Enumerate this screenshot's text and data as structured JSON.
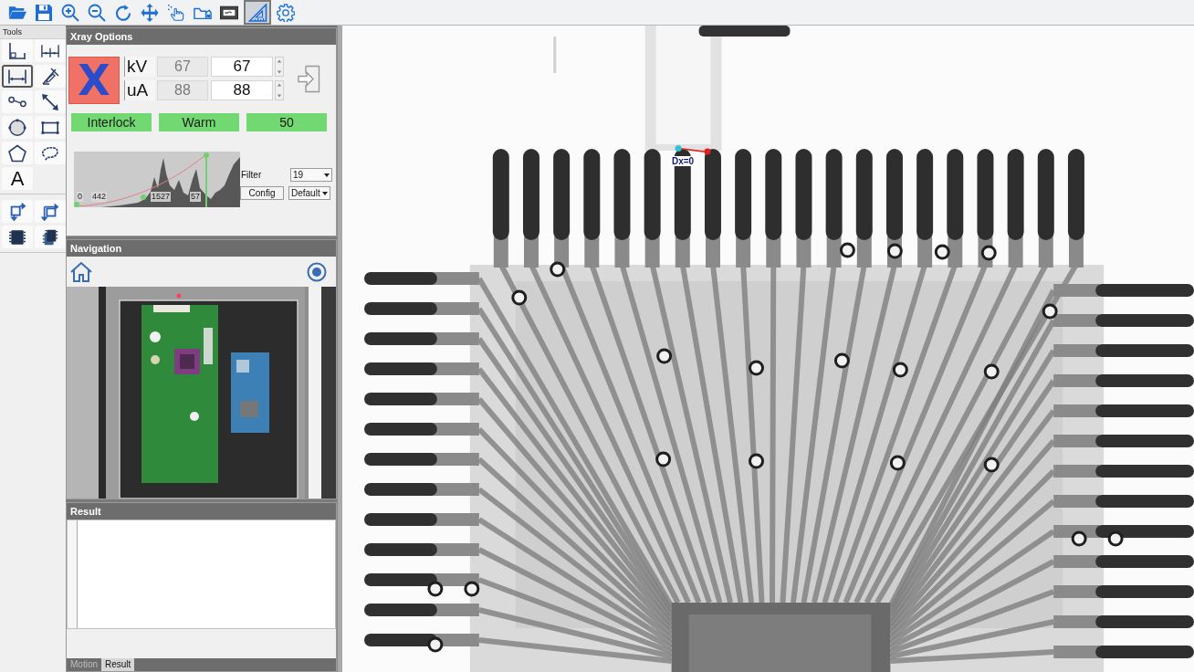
{
  "toolbar": {
    "buttons": [
      {
        "selected": false
      },
      {
        "selected": false
      },
      {
        "selected": false
      },
      {
        "selected": false
      },
      {
        "selected": false
      },
      {
        "selected": false
      },
      {
        "selected": false
      },
      {
        "selected": false
      },
      {
        "selected": false
      },
      {
        "selected": true
      },
      {
        "selected": false
      }
    ]
  },
  "tools": {
    "title": "Tools",
    "groups": [
      {
        "items": [
          {
            "selected": false
          },
          {
            "selected": false
          },
          {
            "selected": true
          },
          {
            "selected": false
          },
          {
            "selected": false
          },
          {
            "selected": false
          },
          {
            "selected": false
          },
          {
            "selected": false
          },
          {
            "selected": false
          },
          {
            "selected": false
          },
          {
            "label": "A",
            "selected": false
          }
        ]
      },
      {
        "items": [
          {
            "selected": false
          },
          {
            "selected": false
          },
          {
            "selected": false
          },
          {
            "selected": false
          }
        ]
      }
    ]
  },
  "xray_options": {
    "title": "Xray Options",
    "source_button": {
      "label": "X"
    },
    "parameters": [
      {
        "label": "kV",
        "reading": "67",
        "value": "67"
      },
      {
        "label": "uA",
        "reading": "88",
        "value": "88"
      }
    ],
    "status": [
      {
        "label": "Interlock"
      },
      {
        "label": "Warm"
      },
      {
        "label": "50"
      }
    ],
    "histogram": {
      "ticks": [
        "0",
        "442",
        "1527",
        "57"
      ]
    },
    "filter": {
      "label": "Filter",
      "value": "19"
    },
    "config_button": "Config",
    "preset": {
      "value": "Default"
    }
  },
  "navigation": {
    "title": "Navigation"
  },
  "result": {
    "title": "Result"
  },
  "bottom_tabs": [
    {
      "label": "Motion",
      "selected": false
    },
    {
      "label": "Result",
      "selected": true
    }
  ],
  "image": {
    "measurement": {
      "label": "Dx=0"
    }
  }
}
